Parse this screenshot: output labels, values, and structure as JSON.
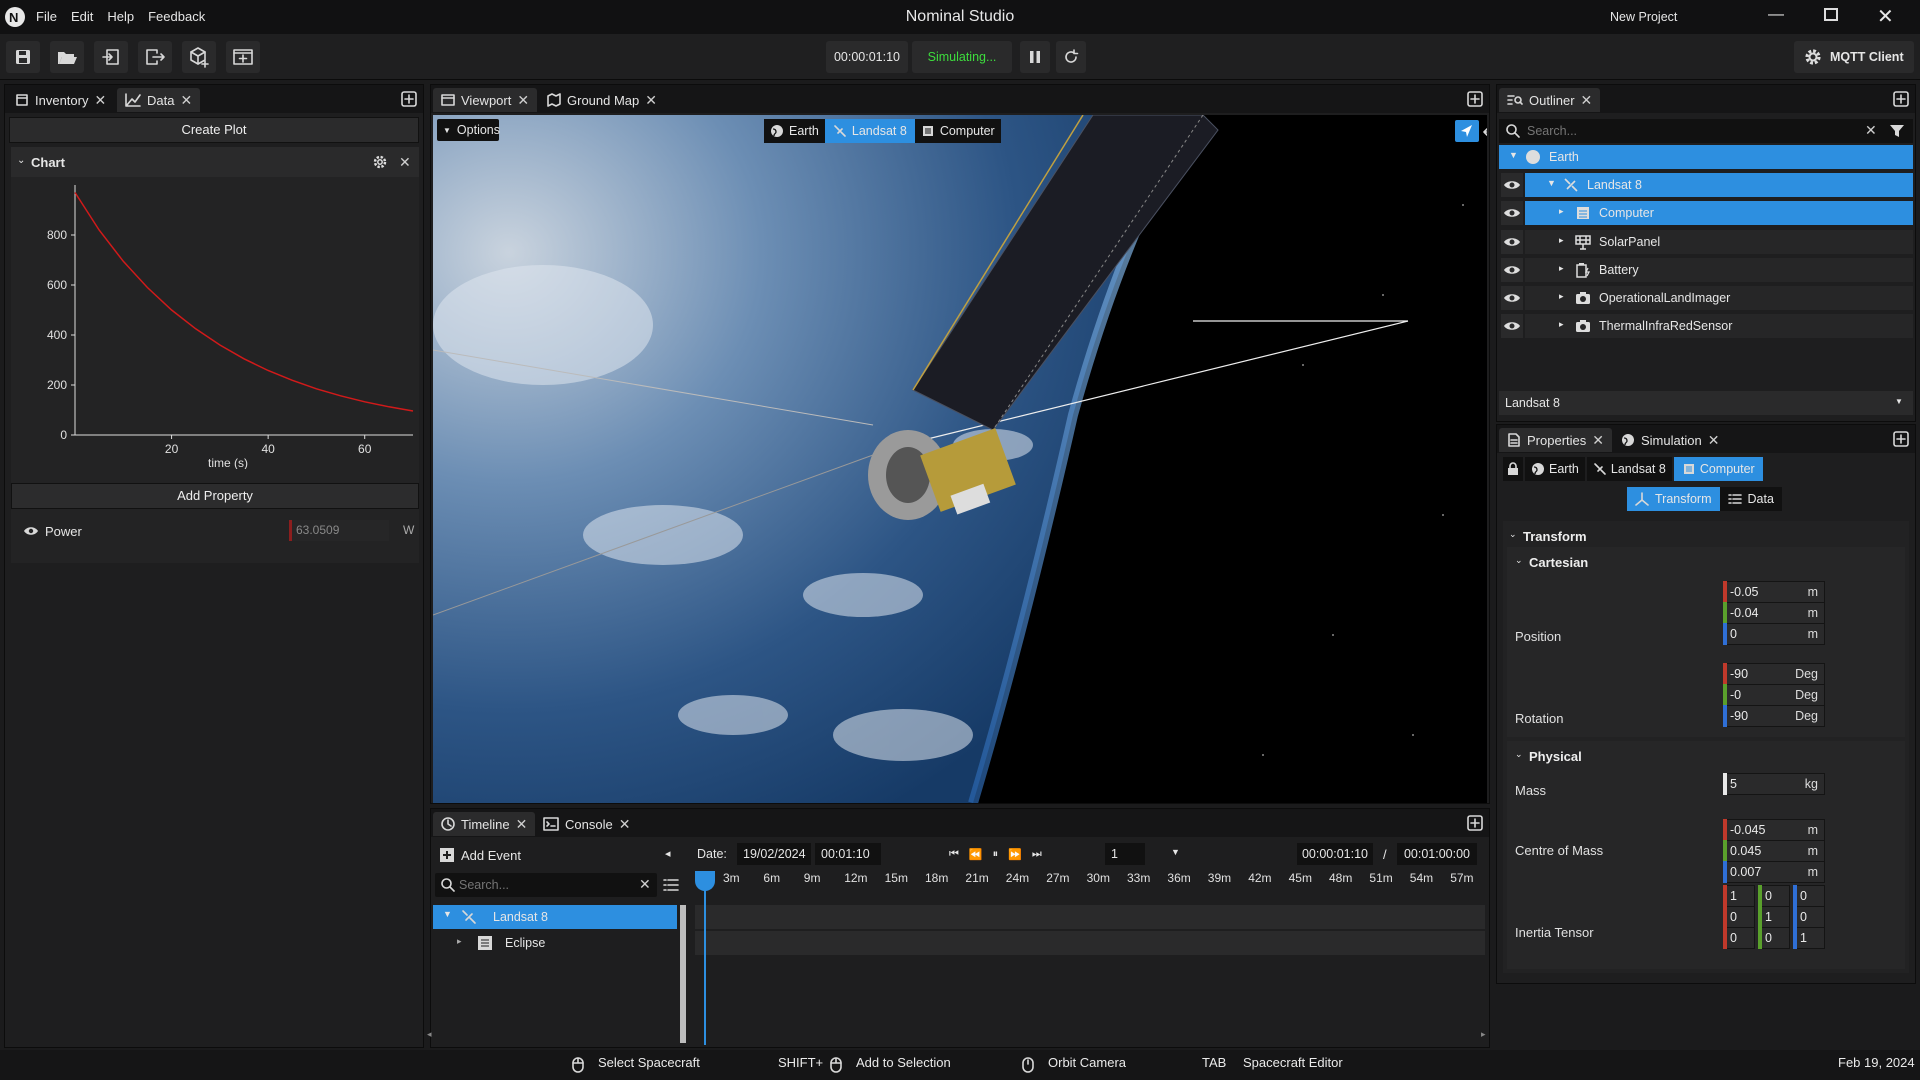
{
  "app": {
    "title": "Nominal Studio",
    "project": "New Project",
    "menu": [
      "File",
      "Edit",
      "Help",
      "Feedback"
    ]
  },
  "toolbar": {
    "sim_time": "00:00:01:10",
    "status": "Simulating...",
    "status_color": "#3ddc3d",
    "mqtt_label": "MQTT Client"
  },
  "left": {
    "tabs": [
      "Inventory",
      "Data"
    ],
    "create_plot": "Create Plot",
    "chart_title": "Chart",
    "add_property": "Add Property",
    "property": {
      "name": "Power",
      "value": "63.0509",
      "unit": "W"
    }
  },
  "chart_data": {
    "type": "line",
    "title": "",
    "xlabel": "time (s)",
    "ylabel": "",
    "xlim": [
      0,
      70
    ],
    "ylim": [
      0,
      1000
    ],
    "x_ticks": [
      "20",
      "40",
      "60"
    ],
    "y_ticks": [
      "0",
      "200",
      "400",
      "600",
      "800"
    ],
    "series": [
      {
        "name": "",
        "color": "#d11a1a",
        "x": [
          0,
          5,
          10,
          15,
          20,
          25,
          30,
          35,
          40,
          45,
          50,
          55,
          60,
          65,
          70
        ],
        "y": [
          970,
          820,
          695,
          590,
          500,
          425,
          360,
          305,
          258,
          219,
          185,
          157,
          133,
          113,
          96
        ]
      }
    ]
  },
  "viewport": {
    "tabs": [
      "Viewport",
      "Ground Map"
    ],
    "options": "Options",
    "breadcrumb": [
      "Earth",
      "Landsat 8",
      "Computer"
    ]
  },
  "timeline": {
    "tabs": [
      "Timeline",
      "Console"
    ],
    "add_event": "Add Event",
    "search_placeholder": "Search...",
    "date_label": "Date:",
    "date": "19/02/2024",
    "time": "00:01:10",
    "speed": "1",
    "current": "00:00:01:10",
    "separator": "/",
    "total": "00:01:00:00",
    "ticks": [
      "3m",
      "6m",
      "9m",
      "12m",
      "15m",
      "18m",
      "21m",
      "24m",
      "27m",
      "30m",
      "33m",
      "36m",
      "39m",
      "42m",
      "45m",
      "48m",
      "51m",
      "54m",
      "57m"
    ],
    "items": [
      "Landsat 8",
      "Eclipse"
    ]
  },
  "outliner": {
    "tab": "Outliner",
    "search_placeholder": "Search...",
    "tree": [
      "Earth",
      "Landsat 8",
      "Computer",
      "SolarPanel",
      "Battery",
      "OperationalLandImager",
      "ThermalInfraRedSensor"
    ],
    "selected_object": "Landsat 8"
  },
  "properties": {
    "tabs": [
      "Properties",
      "Simulation"
    ],
    "breadcrumb": [
      "Earth",
      "Landsat 8",
      "Computer"
    ],
    "subtabs": [
      "Transform",
      "Data"
    ],
    "transform": "Transform",
    "cartesian": "Cartesian",
    "position_label": "Position",
    "position": [
      {
        "v": "-0.05",
        "u": "m"
      },
      {
        "v": "-0.04",
        "u": "m"
      },
      {
        "v": "0",
        "u": "m"
      }
    ],
    "rotation_label": "Rotation",
    "rotation": [
      {
        "v": "-90",
        "u": "Deg"
      },
      {
        "v": "-0",
        "u": "Deg"
      },
      {
        "v": "-90",
        "u": "Deg"
      }
    ],
    "physical": "Physical",
    "mass_label": "Mass",
    "mass": {
      "v": "5",
      "u": "kg"
    },
    "com_label": "Centre of Mass",
    "com": [
      {
        "v": "-0.045",
        "u": "m"
      },
      {
        "v": "0.045",
        "u": "m"
      },
      {
        "v": "0.007",
        "u": "m"
      }
    ],
    "inertia_label": "Inertia Tensor",
    "inertia": [
      [
        "1",
        "0",
        "0"
      ],
      [
        "0",
        "1",
        "0"
      ],
      [
        "0",
        "0",
        "1"
      ]
    ]
  },
  "status": {
    "select": "Select Spacecraft",
    "shift": "SHIFT+",
    "add": "Add to Selection",
    "orbit": "Orbit Camera",
    "tab_key": "TAB",
    "editor": "Spacecraft Editor",
    "date": "Feb 19, 2024"
  },
  "colors": {
    "accent": "#2d8fe0",
    "x_axis": "#c0392b",
    "y_axis": "#5aa02c",
    "z_axis": "#2f6fd6"
  }
}
